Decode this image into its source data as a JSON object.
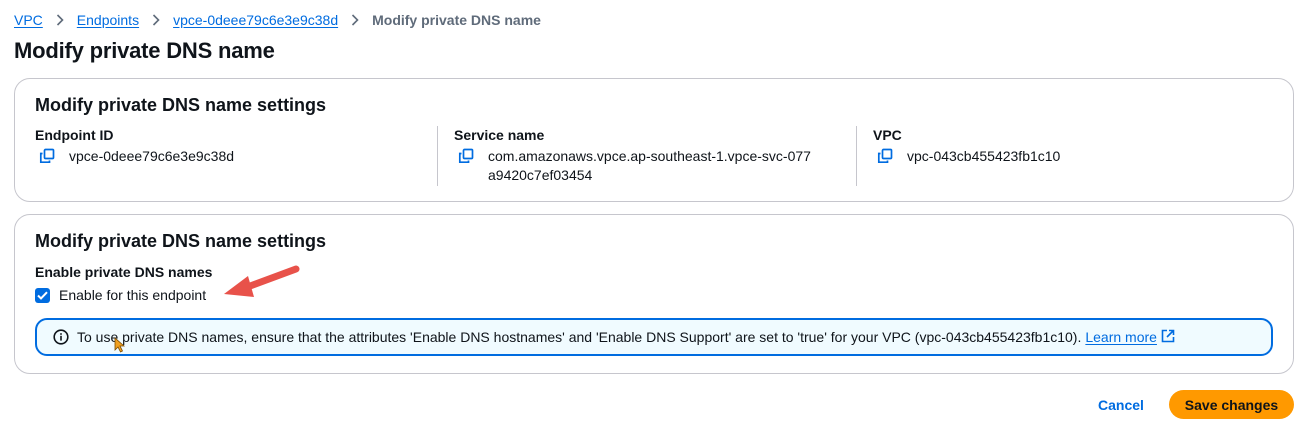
{
  "breadcrumb": {
    "items": [
      {
        "label": "VPC"
      },
      {
        "label": "Endpoints"
      },
      {
        "label": "vpce-0deee79c6e3e9c38d"
      }
    ],
    "current": "Modify private DNS name"
  },
  "page": {
    "title": "Modify private DNS name"
  },
  "details": {
    "header": "Modify private DNS name settings",
    "fields": [
      {
        "label": "Endpoint ID",
        "value": "vpce-0deee79c6e3e9c38d"
      },
      {
        "label": "Service name",
        "value": "com.amazonaws.vpce.ap-southeast-1.vpce-svc-077a9420c7ef03454"
      },
      {
        "label": "VPC",
        "value": "vpc-043cb455423fb1c10"
      }
    ]
  },
  "settings": {
    "header": "Modify private DNS name settings",
    "field_label": "Enable private DNS names",
    "checkbox_label": "Enable for this endpoint",
    "checked": true,
    "alert_text": "To use private DNS names, ensure that the attributes 'Enable DNS hostnames' and 'Enable DNS Support' are set to 'true' for your VPC (vpc-043cb455423fb1c10).",
    "alert_link": "Learn more"
  },
  "actions": {
    "cancel": "Cancel",
    "save": "Save changes"
  },
  "icons": {
    "copy": "copy-icon",
    "info": "info-icon",
    "external": "external-link-icon",
    "chevron": "chevron-right-icon",
    "check": "check-icon"
  },
  "colors": {
    "link": "#006ce0",
    "primary_button": "#ff9900",
    "annotation_arrow": "#e8524a",
    "alert_bg": "#f0fbff"
  }
}
